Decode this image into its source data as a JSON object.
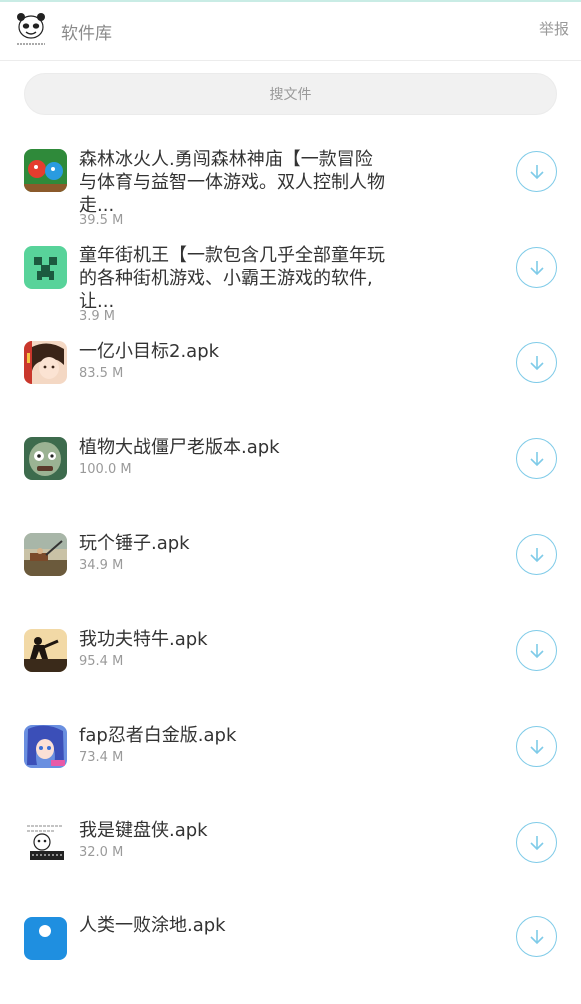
{
  "header": {
    "app_title": "软件库",
    "report_label": "举报",
    "logo_caption": "我了解的那种"
  },
  "search": {
    "placeholder": "搜文件"
  },
  "files": [
    {
      "name": "森林冰火人.勇闯森林神庙【一款冒险与体育与益智一体游戏。双人控制人物走...",
      "size": "39.5 M",
      "icon": "fire-water-game-icon"
    },
    {
      "name": "童年街机王【一款包含几乎全部童年玩的各种街机游戏、小霸王游戏的软件,让...",
      "size": "3.9 M",
      "icon": "creeper-face-icon"
    },
    {
      "name": "一亿小目标2.apk",
      "size": "83.5 M",
      "icon": "anime-girl-icon"
    },
    {
      "name": "植物大战僵尸老版本.apk",
      "size": "100.0 M",
      "icon": "zombie-head-icon"
    },
    {
      "name": "玩个锤子.apk",
      "size": "34.9 M",
      "icon": "hammer-scene-icon"
    },
    {
      "name": "我功夫特牛.apk",
      "size": "95.4 M",
      "icon": "kungfu-silhouette-icon"
    },
    {
      "name": "fap忍者白金版.apk",
      "size": "73.4 M",
      "icon": "ninja-girl-icon"
    },
    {
      "name": "我是键盘侠.apk",
      "size": "32.0 M",
      "icon": "keyboard-meme-icon"
    },
    {
      "name": "人类一败涂地.apk",
      "size": "",
      "icon": "human-fall-icon"
    }
  ],
  "colors": {
    "accent": "#7fcbe8",
    "text": "#333333",
    "muted": "#9a9a9a",
    "search_bg": "#f1f1f1"
  }
}
